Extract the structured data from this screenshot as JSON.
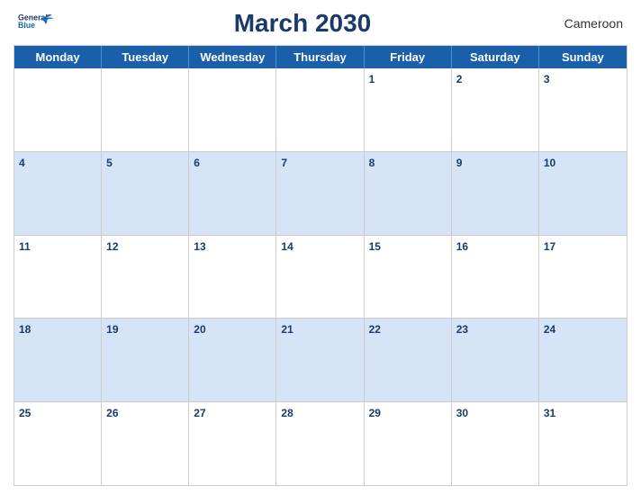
{
  "header": {
    "logo_line1": "General",
    "logo_line2": "Blue",
    "title": "March 2030",
    "country": "Cameroon"
  },
  "calendar": {
    "days_of_week": [
      "Monday",
      "Tuesday",
      "Wednesday",
      "Thursday",
      "Friday",
      "Saturday",
      "Sunday"
    ],
    "rows": [
      {
        "stripe": false,
        "cells": [
          {
            "day": "",
            "empty": true
          },
          {
            "day": "",
            "empty": true
          },
          {
            "day": "",
            "empty": true
          },
          {
            "day": "",
            "empty": true
          },
          {
            "day": "1",
            "empty": false
          },
          {
            "day": "2",
            "empty": false
          },
          {
            "day": "3",
            "empty": false
          }
        ]
      },
      {
        "stripe": true,
        "cells": [
          {
            "day": "4",
            "empty": false
          },
          {
            "day": "5",
            "empty": false
          },
          {
            "day": "6",
            "empty": false
          },
          {
            "day": "7",
            "empty": false
          },
          {
            "day": "8",
            "empty": false
          },
          {
            "day": "9",
            "empty": false
          },
          {
            "day": "10",
            "empty": false
          }
        ]
      },
      {
        "stripe": false,
        "cells": [
          {
            "day": "11",
            "empty": false
          },
          {
            "day": "12",
            "empty": false
          },
          {
            "day": "13",
            "empty": false
          },
          {
            "day": "14",
            "empty": false
          },
          {
            "day": "15",
            "empty": false
          },
          {
            "day": "16",
            "empty": false
          },
          {
            "day": "17",
            "empty": false
          }
        ]
      },
      {
        "stripe": true,
        "cells": [
          {
            "day": "18",
            "empty": false
          },
          {
            "day": "19",
            "empty": false
          },
          {
            "day": "20",
            "empty": false
          },
          {
            "day": "21",
            "empty": false
          },
          {
            "day": "22",
            "empty": false
          },
          {
            "day": "23",
            "empty": false
          },
          {
            "day": "24",
            "empty": false
          }
        ]
      },
      {
        "stripe": false,
        "cells": [
          {
            "day": "25",
            "empty": false
          },
          {
            "day": "26",
            "empty": false
          },
          {
            "day": "27",
            "empty": false
          },
          {
            "day": "28",
            "empty": false
          },
          {
            "day": "29",
            "empty": false
          },
          {
            "day": "30",
            "empty": false
          },
          {
            "day": "31",
            "empty": false
          }
        ]
      }
    ]
  }
}
